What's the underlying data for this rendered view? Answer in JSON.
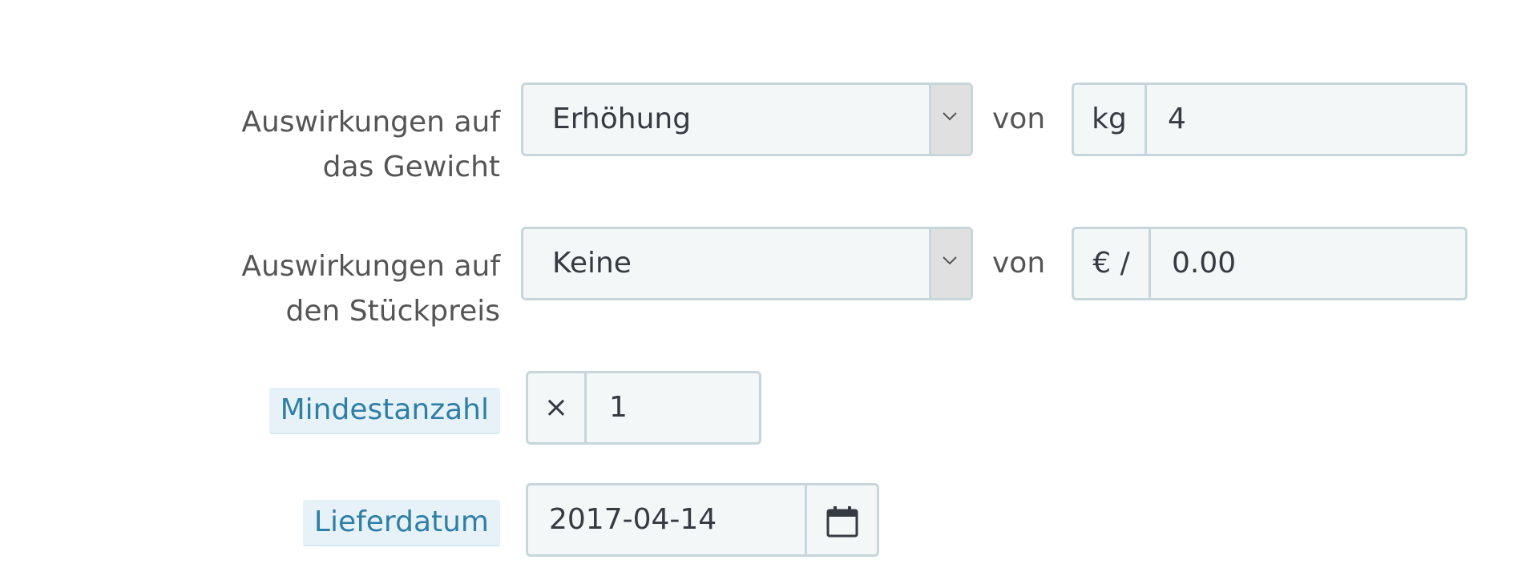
{
  "weight": {
    "label_line1": "Auswirkungen auf",
    "label_line2": "das Gewicht",
    "select_value": "Erhöhung",
    "von": "von",
    "unit": "kg",
    "value": "4"
  },
  "price": {
    "label_line1": "Auswirkungen auf",
    "label_line2": "den Stückpreis",
    "select_value": "Keine",
    "von": "von",
    "unit": "€ /",
    "value": "0.00"
  },
  "min_qty": {
    "label": "Mindestanzahl",
    "prefix": "×",
    "value": "1"
  },
  "delivery": {
    "label": "Lieferdatum",
    "value": "2017-04-14"
  },
  "icons": {
    "select_arrow": "chevron-down-icon",
    "calendar": "calendar-icon"
  },
  "colors": {
    "border": "#c7d6db",
    "input_bg": "#f3f7f8",
    "label_highlight_bg": "#e7f2f8",
    "label_highlight_text": "#2e7fa8"
  }
}
